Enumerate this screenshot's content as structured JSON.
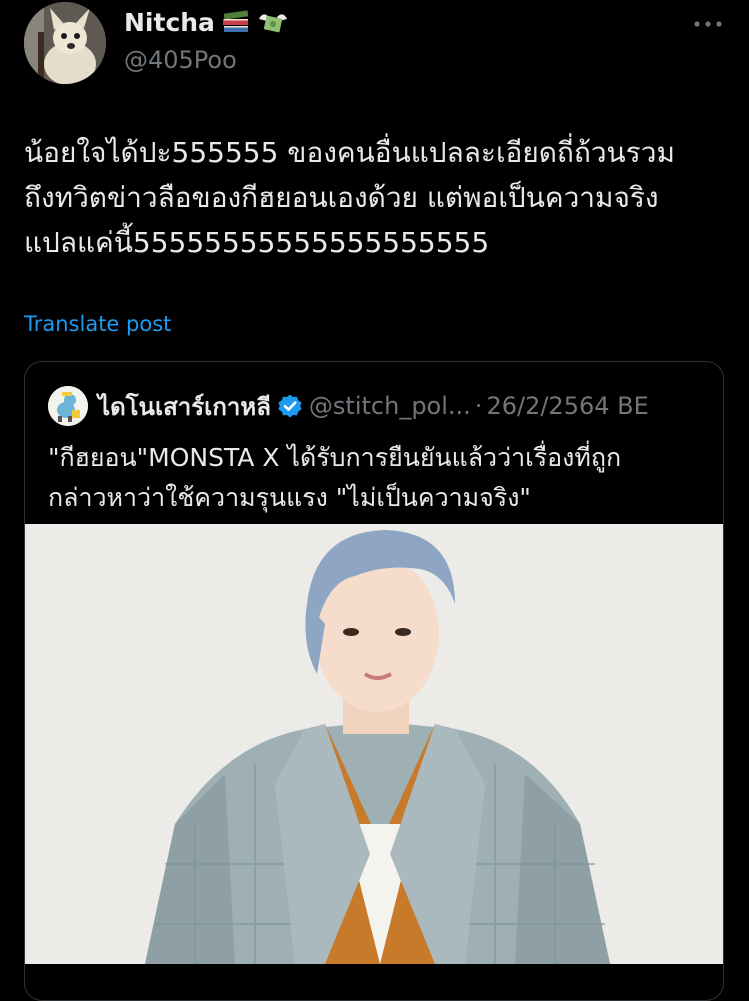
{
  "author": {
    "display_name": "Nitcha",
    "handle": "@405Poo",
    "avatar_icon": "dog-avatar-icon",
    "name_emojis": [
      "books-emoji-icon",
      "money-wings-emoji-icon"
    ]
  },
  "tweet": {
    "text_lines": [
      "น้อยใจได้ปะ555555 ของคนอื่นแปลละเอียดถี่ถ้วนรวม",
      "ถึงทวิตข่าวลือของกีฮยอนเองด้วย แต่พอเป็นความจริง",
      "แปลแค่นี้55555555555555555555"
    ],
    "translate_label": "Translate post"
  },
  "quoted": {
    "display_name": "ไดโนเสาร์เกาหลี",
    "verified_icon": "verified-badge-icon",
    "handle": "@stitch_pol...",
    "separator": "·",
    "date": "26/2/2564 BE",
    "text_lines": [
      "\"กีฮยอน\"MONSTA X ได้รับการยืนยันแล้วว่าเรื่องที่ถูก",
      "กล่าวหาว่าใช้ความรุนแรง \"ไม่เป็นความจริง\""
    ],
    "media_icon": "person-photo-icon"
  },
  "colors": {
    "background": "#000000",
    "text": "#e7e9ea",
    "muted": "#71767b",
    "link": "#1d9bf0",
    "verified": "#1d9bf0",
    "border": "#2f3336"
  }
}
